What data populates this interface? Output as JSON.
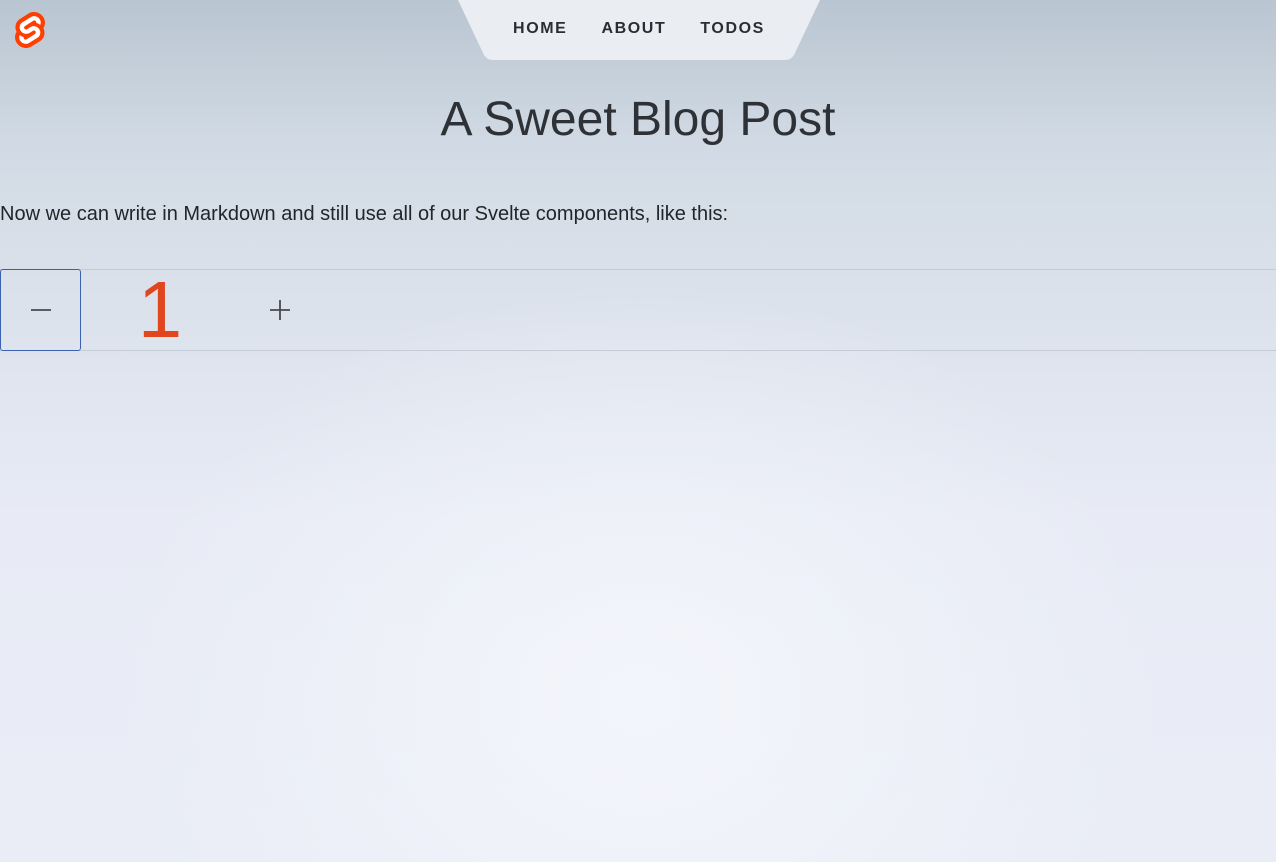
{
  "header": {
    "logo_icon": "svelte-logo-icon",
    "nav": {
      "items": [
        {
          "label": "HOME"
        },
        {
          "label": "ABOUT"
        },
        {
          "label": "TODOS"
        }
      ]
    }
  },
  "main": {
    "title": "A Sweet Blog Post",
    "paragraph": "Now we can write in Markdown and still use all of our Svelte components, like this:",
    "counter": {
      "decrement_icon": "minus-icon",
      "increment_icon": "plus-icon",
      "value": "1"
    }
  },
  "colors": {
    "brand": "#ff3e00",
    "counter_value": "#e2461f",
    "focus_outline": "#3a62b0",
    "nav_background": "#eaeef3"
  }
}
